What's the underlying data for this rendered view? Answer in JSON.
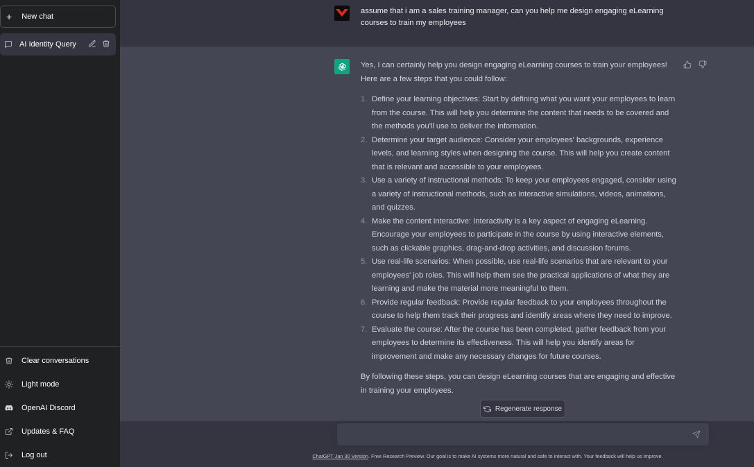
{
  "sidebar": {
    "new_chat_label": "New chat",
    "history": [
      {
        "title": "AI Identity Query"
      }
    ],
    "bottom_items": [
      {
        "label": "Clear conversations",
        "icon": "trash-icon"
      },
      {
        "label": "Light mode",
        "icon": "sun-icon"
      },
      {
        "label": "OpenAI Discord",
        "icon": "discord-icon"
      },
      {
        "label": "Updates & FAQ",
        "icon": "external-link-icon"
      },
      {
        "label": "Log out",
        "icon": "logout-icon"
      }
    ]
  },
  "conversation": {
    "user_message": "assume that i am a sales training manager, can you help me design engaging eLearning courses to train my employees",
    "assistant_intro": "Yes, I can certainly help you design engaging eLearning courses to train your employees! Here are a few steps that you could follow:",
    "steps": [
      {
        "num": "1.",
        "text": "Define your learning objectives: Start by defining what you want your employees to learn from the course. This will help you determine the content that needs to be covered and the methods you'll use to deliver the information."
      },
      {
        "num": "2.",
        "text": "Determine your target audience: Consider your employees' backgrounds, experience levels, and learning styles when designing the course. This will help you create content that is relevant and accessible to your employees."
      },
      {
        "num": "3.",
        "text": "Use a variety of instructional methods: To keep your employees engaged, consider using a variety of instructional methods, such as interactive simulations, videos, animations, and quizzes."
      },
      {
        "num": "4.",
        "text": "Make the content interactive: Interactivity is a key aspect of engaging eLearning. Encourage your employees to participate in the course by using interactive elements, such as clickable graphics, drag-and-drop activities, and discussion forums."
      },
      {
        "num": "5.",
        "text": "Use real-life scenarios: When possible, use real-life scenarios that are relevant to your employees' job roles. This will help them see the practical applications of what they are learning and make the material more meaningful to them."
      },
      {
        "num": "6.",
        "text": "Provide regular feedback: Provide regular feedback to your employees throughout the course to help them track their progress and identify areas where they need to improve."
      },
      {
        "num": "7.",
        "text": "Evaluate the course: After the course has been completed, gather feedback from your employees to determine its effectiveness. This will help you identify areas for improvement and make any necessary changes for future courses."
      }
    ],
    "assistant_outro": "By following these steps, you can design eLearning courses that are engaging and effective in training your employees."
  },
  "regenerate_label": "Regenerate response",
  "input": {
    "value": "",
    "placeholder": ""
  },
  "footer": {
    "version_link": "ChatGPT Jan 30 Version",
    "note": ". Free Research Preview. Our goal is to make AI systems more natural and safe to interact with. Your feedback will help us improve."
  },
  "colors": {
    "sidebar_bg": "#202123",
    "main_bg": "#343541",
    "assistant_bg": "#444654",
    "gpt_green": "#10a37f",
    "user_avatar_red": "#e1261c"
  }
}
